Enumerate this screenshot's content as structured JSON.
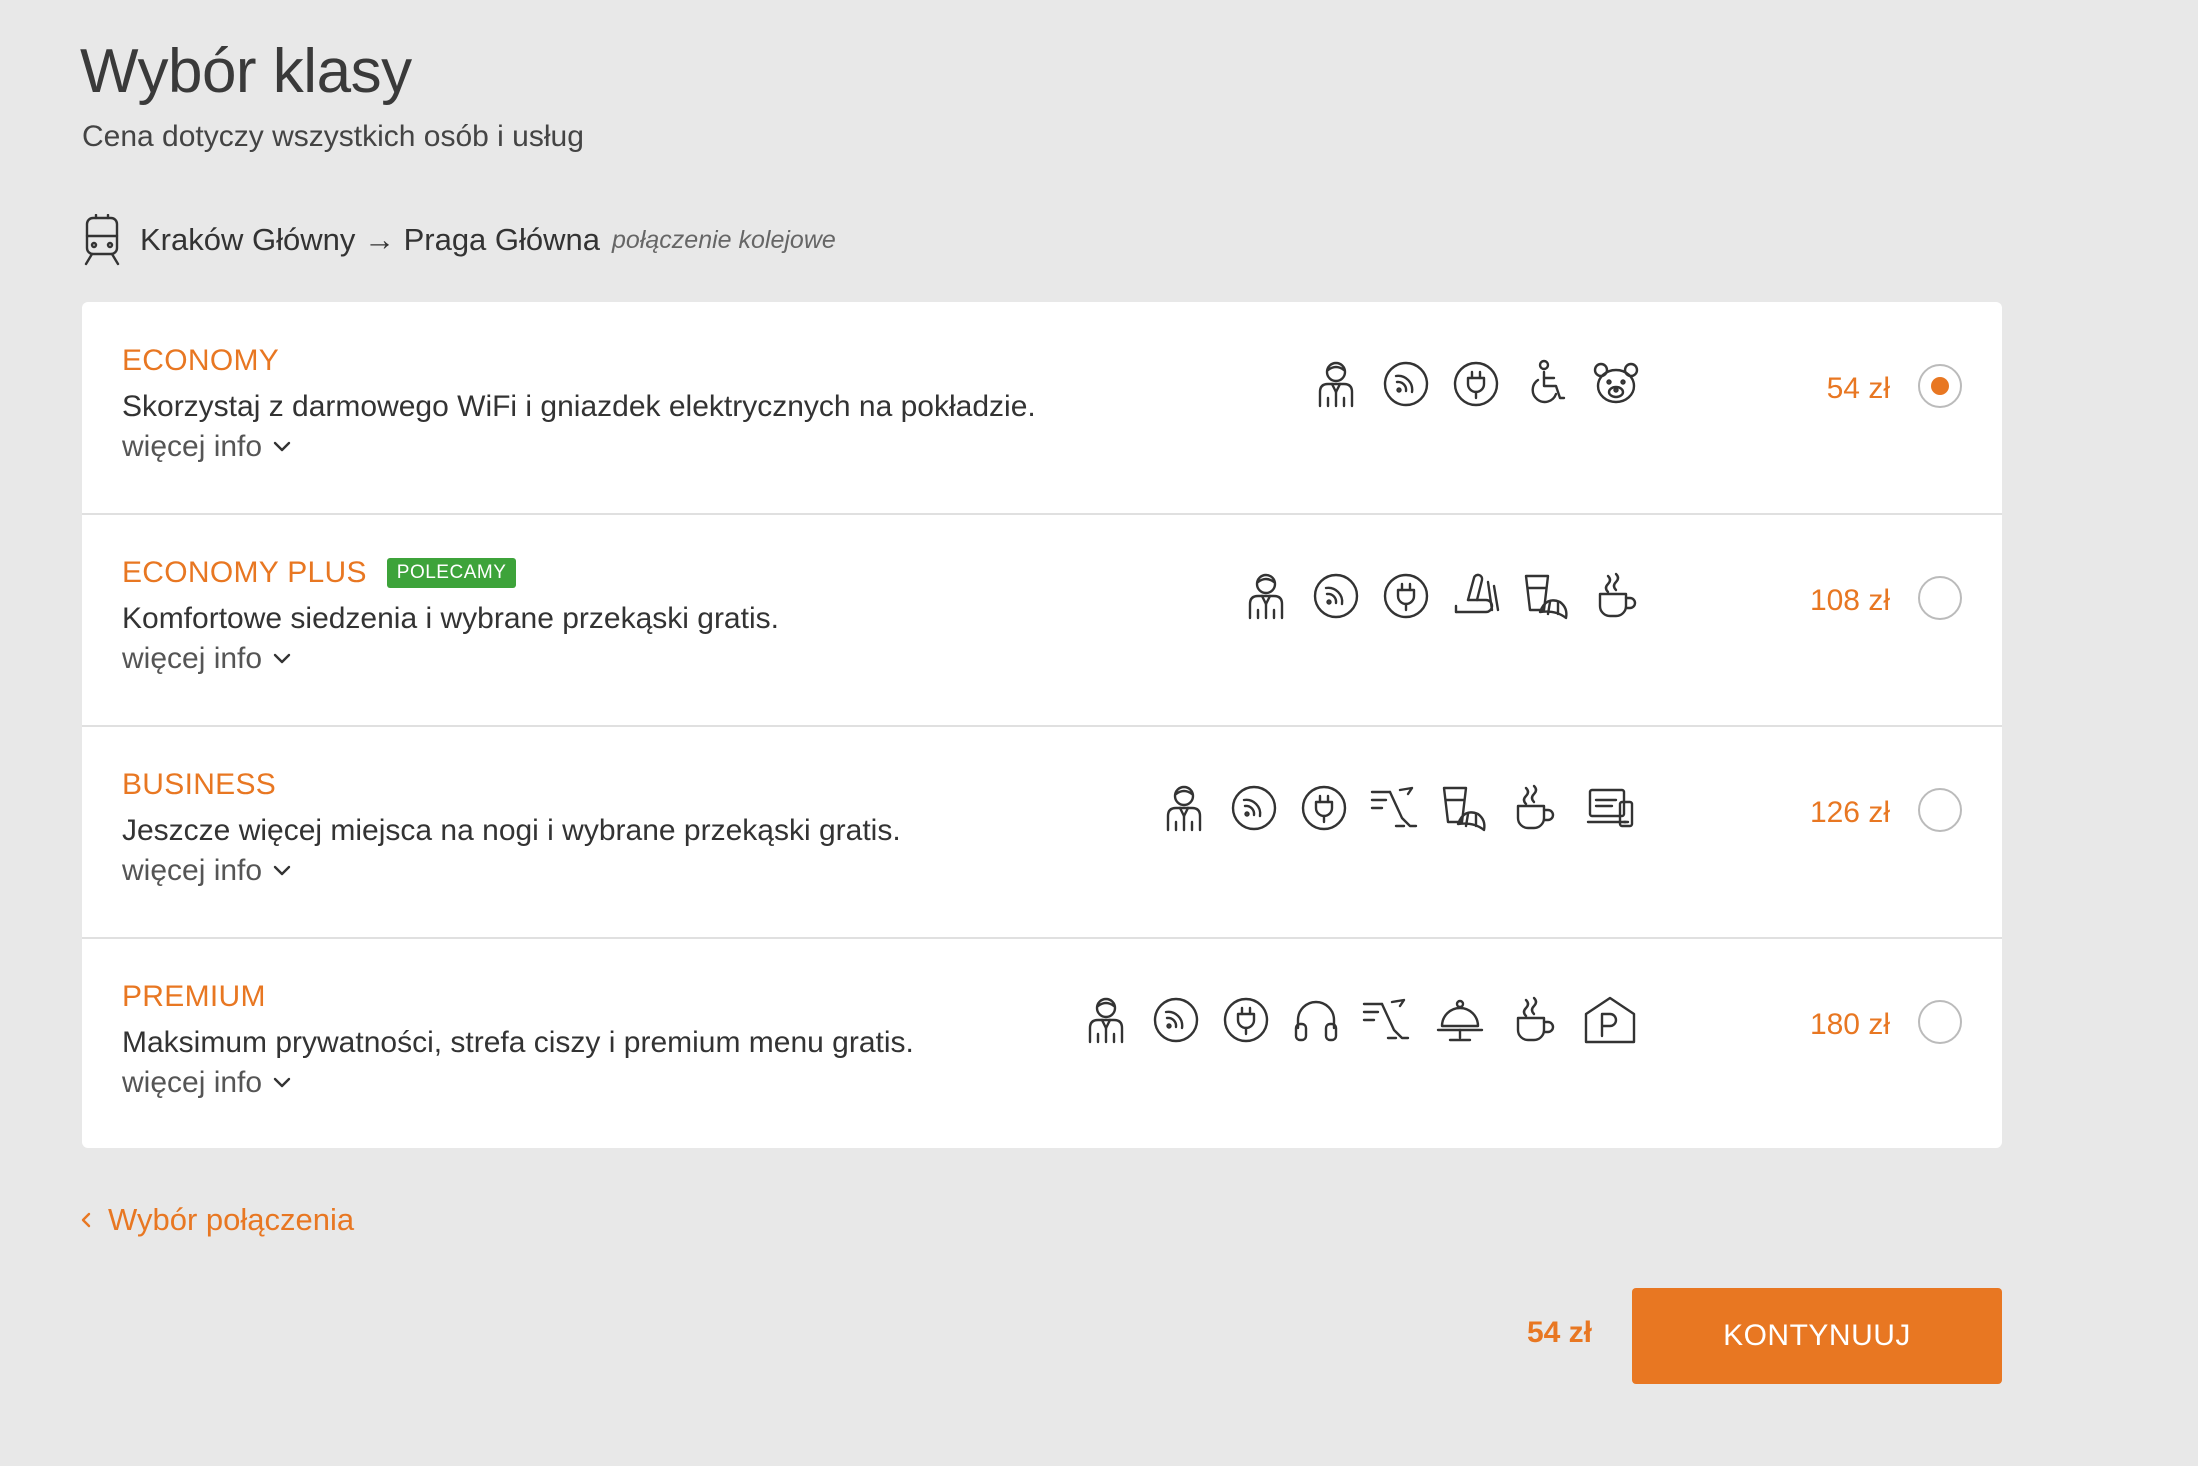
{
  "header": {
    "title": "Wybór klasy",
    "subtitle": "Cena dotyczy wszystkich osób i usług"
  },
  "route": {
    "icon": "train-icon",
    "text": "Kraków Główny → Praga Główna",
    "type": "połączenie kolejowe"
  },
  "classes": [
    {
      "name": "ECONOMY",
      "badge": "",
      "description": "Skorzystaj z darmowego WiFi i gniazdek elektrycznych na pokładzie.",
      "more": "więcej info",
      "price": "54 zł",
      "selected": true,
      "amenities": [
        "steward-icon",
        "wifi-icon",
        "power-outlet-icon",
        "wheelchair-icon",
        "teddy-bear-icon"
      ]
    },
    {
      "name": "ECONOMY PLUS",
      "badge": "POLECAMY",
      "description": "Komfortowe siedzenia i wybrane przekąski gratis.",
      "more": "więcej info",
      "price": "108 zł",
      "selected": false,
      "amenities": [
        "steward-icon",
        "wifi-icon",
        "power-outlet-icon",
        "reclining-seat-icon",
        "snack-icon",
        "coffee-icon"
      ]
    },
    {
      "name": "BUSINESS",
      "badge": "",
      "description": "Jeszcze więcej miejsca na nogi i wybrane przekąski gratis.",
      "more": "więcej info",
      "price": "126 zł",
      "selected": false,
      "amenities": [
        "steward-icon",
        "wifi-icon",
        "power-outlet-icon",
        "legroom-icon",
        "snack-icon",
        "coffee-icon",
        "entertainment-icon"
      ]
    },
    {
      "name": "PREMIUM",
      "badge": "",
      "description": "Maksimum prywatności, strefa ciszy i premium menu gratis.",
      "more": "więcej info",
      "price": "180 zł",
      "selected": false,
      "amenities": [
        "steward-icon",
        "wifi-icon",
        "power-outlet-icon",
        "headphones-icon",
        "legroom-icon",
        "meal-icon",
        "coffee-icon",
        "parking-icon"
      ]
    }
  ],
  "footer": {
    "back_label": "Wybór połączenia",
    "total": "54 zł",
    "continue_label": "KONTYNUUJ"
  },
  "colors": {
    "accent": "#e87722",
    "badge": "#3da33a",
    "background": "#e8e8e8"
  }
}
